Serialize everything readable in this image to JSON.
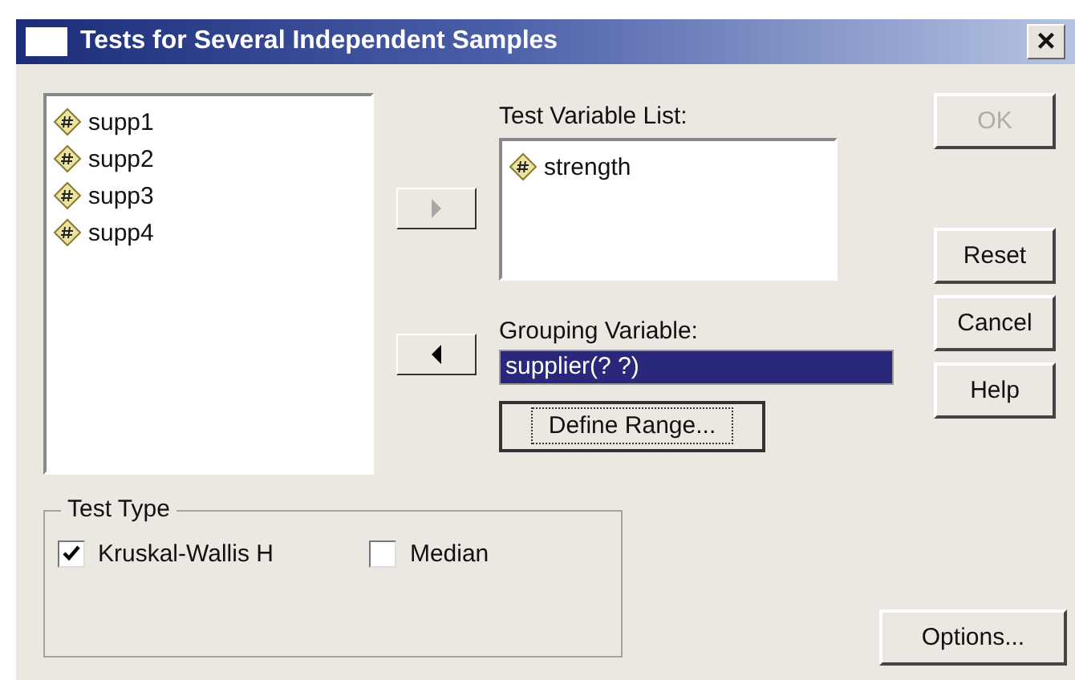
{
  "window": {
    "title": "Tests for Several Independent Samples",
    "close": "×"
  },
  "source_list": {
    "items": [
      {
        "label": "supp1"
      },
      {
        "label": "supp2"
      },
      {
        "label": "supp3"
      },
      {
        "label": "supp4"
      }
    ]
  },
  "move_buttons": [
    {
      "kind": "right",
      "disabled": true
    },
    {
      "kind": "left",
      "disabled": false
    }
  ],
  "test_variable_list": {
    "label": "Test Variable List:",
    "items": [
      {
        "label": "strength"
      }
    ]
  },
  "grouping_variable": {
    "label": "Grouping Variable:",
    "value": "supplier(? ?)",
    "selected": true
  },
  "define_range": {
    "label": "Define Range...",
    "focused": true
  },
  "side_buttons": [
    {
      "label": "OK",
      "disabled": true
    },
    {
      "label": "Reset",
      "disabled": false
    },
    {
      "label": "Cancel",
      "disabled": false
    },
    {
      "label": "Help",
      "disabled": false
    }
  ],
  "test_type": {
    "title": "Test Type",
    "options": [
      {
        "label": "Kruskal-Wallis H",
        "checked": true
      },
      {
        "label": "Median",
        "checked": false
      }
    ]
  },
  "options_button": {
    "label": "Options..."
  }
}
